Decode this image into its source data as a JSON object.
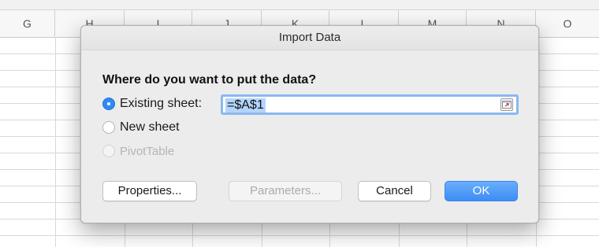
{
  "spreadsheet": {
    "columns": [
      "G",
      "H",
      "I",
      "J",
      "K",
      "L",
      "M",
      "N",
      "O"
    ]
  },
  "dialog": {
    "title": "Import Data",
    "question": "Where do you want to put the data?",
    "options": {
      "existing_sheet": "Existing sheet:",
      "new_sheet": "New sheet",
      "pivot_table": "PivotTable"
    },
    "selected_option": "existing_sheet",
    "reference_value": "=$A$1",
    "buttons": {
      "properties": "Properties...",
      "parameters": "Parameters...",
      "cancel": "Cancel",
      "ok": "OK"
    }
  },
  "colors": {
    "accent": "#2f8bf4",
    "ok_button": "#3d8df5",
    "selection": "#b3d4fb",
    "focus_ring": "#8ab8f1"
  },
  "icons": {
    "collapse_dialog": "range-selector-icon"
  }
}
